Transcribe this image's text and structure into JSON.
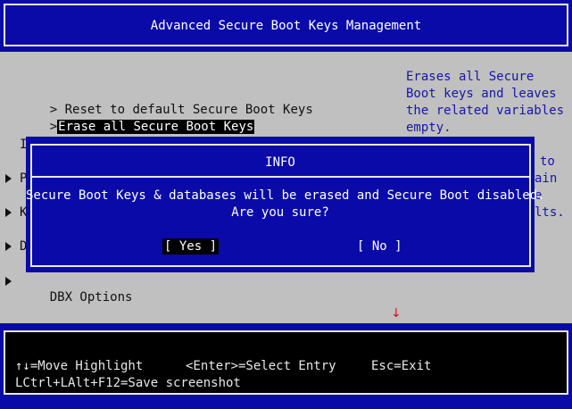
{
  "header": {
    "title": "Advanced Secure Boot Keys Management"
  },
  "menu": {
    "items": [
      {
        "prefix": ">",
        "label": "Reset to default Secure Boot Keys"
      },
      {
        "prefix": ">",
        "label": "Erase all Secure Boot Keys"
      }
    ],
    "partial_left_chars": [
      "I",
      "P",
      "K",
      "D"
    ],
    "dbx_options": "DBX Options"
  },
  "help": {
    "lines": [
      "Erases all Secure",
      "Boot keys and leaves",
      "the related variables",
      "empty."
    ],
    "partial_fragments": [
      "to",
      "ain",
      "e",
      "lts."
    ]
  },
  "dialog": {
    "title": "INFO",
    "message_line1": "Secure Boot Keys & databases will be erased and Secure Boot disabled.",
    "message_line2": "Are you sure?",
    "yes_label": "[ Yes ]",
    "no_label": "[ No ]"
  },
  "scroll_indicator": "↓",
  "footer": {
    "move_highlight": "↑↓=Move Highlight",
    "select_entry": "<Enter>=Select Entry",
    "exit": "Esc=Exit",
    "screenshot": "LCtrl+LAlt+F12=Save screenshot"
  },
  "colors": {
    "bios_blue": "#0a0aa8",
    "bios_gray": "#c0c0c0",
    "help_text": "#1616a8",
    "highlight_bg": "#000000",
    "scroll_arrow": "#e01010"
  }
}
